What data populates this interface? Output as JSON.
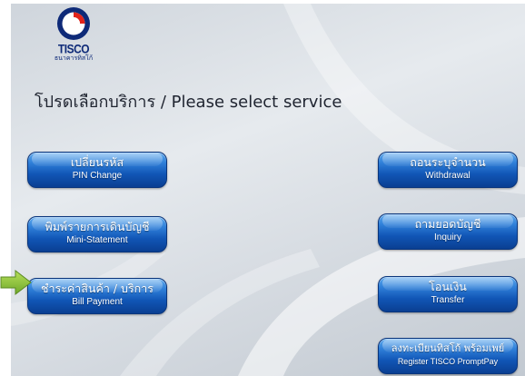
{
  "brand": {
    "name": "TISCO",
    "subtitle": "ธนาคารทิสโก้",
    "accent_color": "#0e2a78",
    "logo_icon": "tisco-logo-icon"
  },
  "screen": {
    "title": "โปรดเลือกบริการ / Please select service"
  },
  "buttons": {
    "pin_change": {
      "thai": "เปลี่ยนรหัส",
      "english": "PIN Change"
    },
    "mini_statement": {
      "thai": "พิมพ์รายการเดินบัญชี",
      "english": "Mini-Statement"
    },
    "bill_payment": {
      "thai": "ชำระค่าสินค้า / บริการ",
      "english": "Bill Payment"
    },
    "withdrawal": {
      "thai": "ถอนระบุจำนวน",
      "english": "Withdrawal"
    },
    "inquiry": {
      "thai": "ถามยอดบัญชี",
      "english": "Inquiry"
    },
    "transfer": {
      "thai": "โอนเงิน",
      "english": "Transfer"
    },
    "promptpay": {
      "thai": "ลงทะเบียนทิสโก้ พร้อมเพย์",
      "english": "Register TISCO PromptPay"
    }
  },
  "colors": {
    "button_top": "#5aa8ee",
    "button_bottom": "#0a3f92",
    "pointer_arrow": "#8cc63f"
  },
  "icons": {
    "pointer": "right-arrow-icon"
  }
}
